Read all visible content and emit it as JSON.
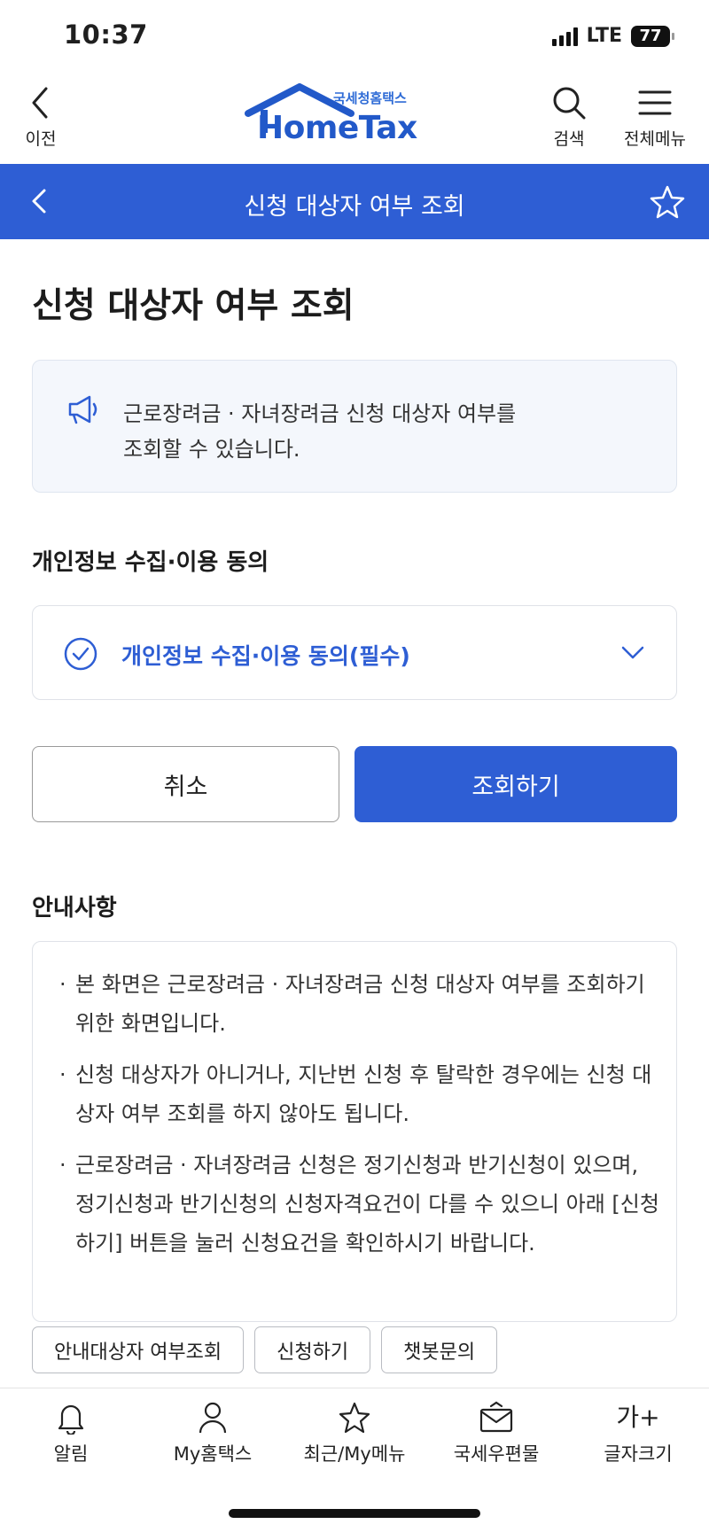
{
  "status": {
    "time": "10:37",
    "network": "LTE",
    "battery": "77"
  },
  "header": {
    "back_label": "이전",
    "logo_sub": "국세청홈택스",
    "logo_main": "HomeTax",
    "search_label": "검색",
    "menu_label": "전체메뉴"
  },
  "title_bar": {
    "title": "신청 대상자 여부 조회"
  },
  "page": {
    "title": "신청 대상자 여부 조회",
    "notice_line1": "근로장려금 · 자녀장려금 신청 대상자 여부를",
    "notice_line2": "조회할 수 있습니다."
  },
  "consent": {
    "section_title": "개인정보 수집·이용 동의",
    "item_label": "개인정보 수집·이용 동의(필수)"
  },
  "actions": {
    "cancel_label": "취소",
    "query_label": "조회하기"
  },
  "info": {
    "title": "안내사항",
    "items": [
      "본 화면은 근로장려금 · 자녀장려금 신청 대상자 여부를 조회하기 위한 화면입니다.",
      "신청 대상자가 아니거나, 지난번 신청 후 탈락한 경우에는 신청 대상자 여부 조회를 하지 않아도 됩니다.",
      "근로장려금 · 자녀장려금 신청은 정기신청과 반기신청이 있으며, 정기신청과 반기신청의 신청자격요건이 다를 수 있으니 아래 [신청하기] 버튼을 눌러 신청요건을 확인하시기 바랍니다."
    ]
  },
  "quick_links": [
    "안내대상자 여부조회",
    "신청하기",
    "챗봇문의"
  ],
  "tabs": [
    {
      "label": "알림",
      "icon": "bell-icon"
    },
    {
      "label": "My홈택스",
      "icon": "person-icon"
    },
    {
      "label": "최근/My메뉴",
      "icon": "star-icon"
    },
    {
      "label": "국세우편물",
      "icon": "mail-icon"
    },
    {
      "label": "글자크기",
      "icon": "font-size-icon",
      "glyph": "가+"
    }
  ],
  "colors": {
    "primary": "#2e5ed4",
    "notice_bg": "#f4f7fc",
    "logo_blue": "#2259c9"
  }
}
